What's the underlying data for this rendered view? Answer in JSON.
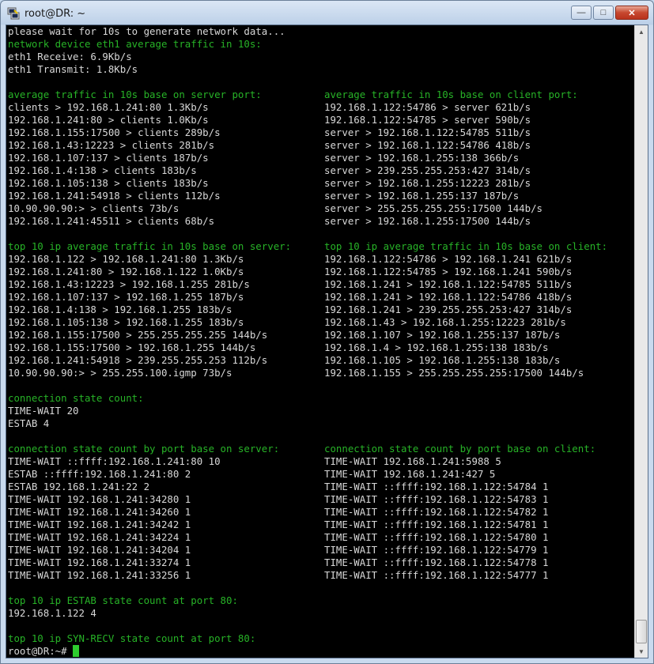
{
  "window": {
    "title": "root@DR: ~",
    "minimize": "—",
    "maximize": "□",
    "close": "✕"
  },
  "terminal": {
    "header": [
      {
        "t": "please wait for 10s to generate network data...",
        "g": false
      },
      {
        "t": "network device eth1 average traffic in 10s:",
        "g": true
      },
      {
        "t": "eth1 Receive: 6.9Kb/s",
        "g": false
      },
      {
        "t": "eth1 Transmit: 1.8Kb/s",
        "g": false
      },
      {
        "t": "",
        "g": false
      }
    ],
    "sections": [
      {
        "left_title": "average traffic in 10s base on server port:",
        "right_title": "average traffic in 10s base on client port:",
        "left": [
          "clients > 192.168.1.241:80 1.3Kb/s",
          "192.168.1.241:80 > clients 1.0Kb/s",
          "192.168.1.155:17500 > clients 289b/s",
          "192.168.1.43:12223 > clients 281b/s",
          "192.168.1.107:137 > clients 187b/s",
          "192.168.1.4:138 > clients 183b/s",
          "192.168.1.105:138 > clients 183b/s",
          "192.168.1.241:54918 > clients 112b/s",
          "10.90.90.90:> > clients 73b/s",
          "192.168.1.241:45511 > clients 68b/s"
        ],
        "right": [
          "192.168.1.122:54786 > server 621b/s",
          "192.168.1.122:54785 > server 590b/s",
          "server > 192.168.1.122:54785 511b/s",
          "server > 192.168.1.122:54786 418b/s",
          "server > 192.168.1.255:138 366b/s",
          "server > 239.255.255.253:427 314b/s",
          "server > 192.168.1.255:12223 281b/s",
          "server > 192.168.1.255:137 187b/s",
          "server > 255.255.255.255:17500 144b/s",
          "server > 192.168.1.255:17500 144b/s"
        ]
      },
      {
        "left_title": "top 10 ip average traffic in 10s base on server:",
        "right_title": "top 10 ip average traffic in 10s base on client:",
        "left": [
          "192.168.1.122 > 192.168.1.241:80 1.3Kb/s",
          "192.168.1.241:80 > 192.168.1.122 1.0Kb/s",
          "192.168.1.43:12223 > 192.168.1.255 281b/s",
          "192.168.1.107:137 > 192.168.1.255 187b/s",
          "192.168.1.4:138 > 192.168.1.255 183b/s",
          "192.168.1.105:138 > 192.168.1.255 183b/s",
          "192.168.1.155:17500 > 255.255.255.255 144b/s",
          "192.168.1.155:17500 > 192.168.1.255 144b/s",
          "192.168.1.241:54918 > 239.255.255.253 112b/s",
          "10.90.90.90:> > 255.255.100.igmp 73b/s"
        ],
        "right": [
          "192.168.1.122:54786 > 192.168.1.241 621b/s",
          "192.168.1.122:54785 > 192.168.1.241 590b/s",
          "192.168.1.241 > 192.168.1.122:54785 511b/s",
          "192.168.1.241 > 192.168.1.122:54786 418b/s",
          "192.168.1.241 > 239.255.255.253:427 314b/s",
          "192.168.1.43 > 192.168.1.255:12223 281b/s",
          "192.168.1.107 > 192.168.1.255:137 187b/s",
          "192.168.1.4 > 192.168.1.255:138 183b/s",
          "192.168.1.105 > 192.168.1.255:138 183b/s",
          "192.168.1.155 > 255.255.255.255:17500 144b/s"
        ]
      },
      {
        "left_title": "connection state count:",
        "right_title": "",
        "left": [
          "TIME-WAIT 20",
          "ESTAB 4"
        ],
        "right": []
      },
      {
        "left_title": "connection state count by port base on server:",
        "right_title": "connection state count by port base on client:",
        "left": [
          "TIME-WAIT ::ffff:192.168.1.241:80 10",
          "ESTAB ::ffff:192.168.1.241:80 2",
          "ESTAB 192.168.1.241:22 2",
          "TIME-WAIT 192.168.1.241:34280 1",
          "TIME-WAIT 192.168.1.241:34260 1",
          "TIME-WAIT 192.168.1.241:34242 1",
          "TIME-WAIT 192.168.1.241:34224 1",
          "TIME-WAIT 192.168.1.241:34204 1",
          "TIME-WAIT 192.168.1.241:33274 1",
          "TIME-WAIT 192.168.1.241:33256 1"
        ],
        "right": [
          "TIME-WAIT 192.168.1.241:5988 5",
          "TIME-WAIT 192.168.1.241:427 5",
          "TIME-WAIT ::ffff:192.168.1.122:54784 1",
          "TIME-WAIT ::ffff:192.168.1.122:54783 1",
          "TIME-WAIT ::ffff:192.168.1.122:54782 1",
          "TIME-WAIT ::ffff:192.168.1.122:54781 1",
          "TIME-WAIT ::ffff:192.168.1.122:54780 1",
          "TIME-WAIT ::ffff:192.168.1.122:54779 1",
          "TIME-WAIT ::ffff:192.168.1.122:54778 1",
          "TIME-WAIT ::ffff:192.168.1.122:54777 1"
        ]
      },
      {
        "left_title": "top 10 ip ESTAB state count at port 80:",
        "right_title": "",
        "left": [
          "192.168.1.122 4"
        ],
        "right": []
      },
      {
        "left_title": "top 10 ip SYN-RECV state count at port 80:",
        "right_title": "",
        "left": [],
        "right": [],
        "no_blank_after": true
      }
    ],
    "prompt": "root@DR:~# "
  },
  "colors": {
    "green": "#27b327",
    "text": "#d8d8d8",
    "cursor": "#2ecc2e"
  }
}
